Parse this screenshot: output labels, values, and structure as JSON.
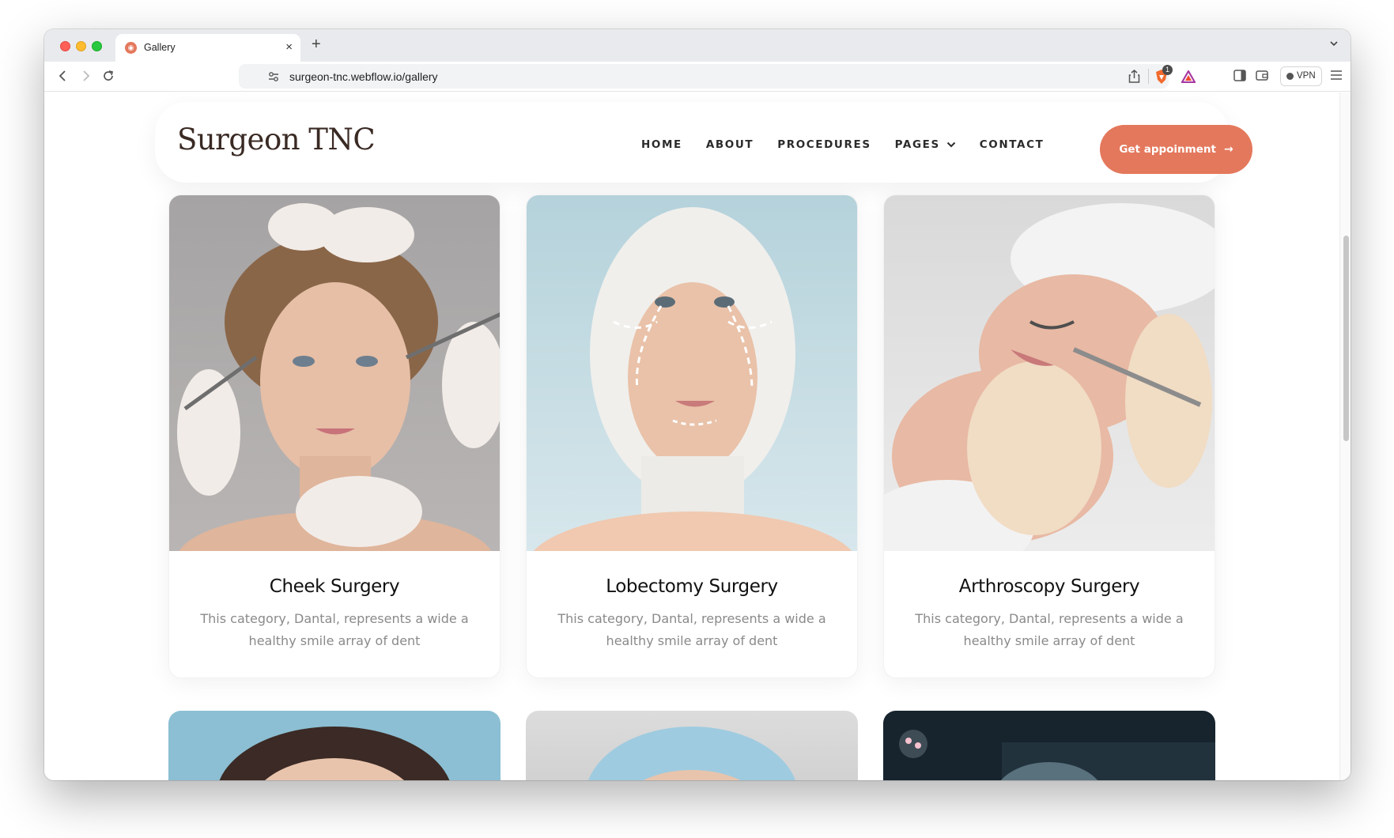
{
  "browser": {
    "tab_title": "Gallery",
    "tab_favicon": "surgeon-logo-icon",
    "new_tab": "+",
    "close": "×",
    "url": "surgeon-tnc.webflow.io/gallery",
    "vpn_label": "VPN",
    "shields_count": "1"
  },
  "site": {
    "logo": "Surgeon TNC",
    "nav": [
      {
        "label": "HOME"
      },
      {
        "label": "ABOUT"
      },
      {
        "label": "PROCEDURES"
      },
      {
        "label": "PAGES"
      },
      {
        "label": "CONTACT"
      }
    ],
    "cta_label": "Get appoinment",
    "accent_color": "#e4785c"
  },
  "gallery": {
    "cards": [
      {
        "title": "Cheek Surgery",
        "description": "This category, Dantal, represents a wide a healthy smile array of dent"
      },
      {
        "title": "Lobectomy Surgery",
        "description": "This category, Dantal, represents a wide a healthy smile array of dent"
      },
      {
        "title": "Arthroscopy Surgery",
        "description": "This category, Dantal, represents a wide a healthy smile array of dent"
      }
    ]
  }
}
